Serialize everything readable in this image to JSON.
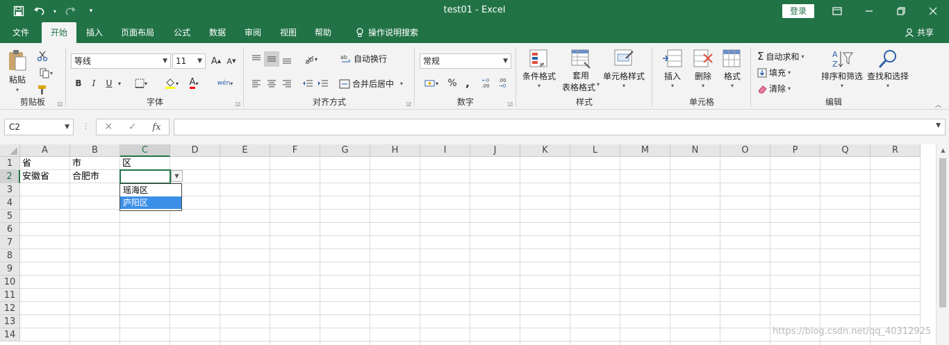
{
  "window": {
    "title": "test01  -  Excel",
    "login_label": "登录",
    "share_label": "共享"
  },
  "tabs": [
    "文件",
    "开始",
    "插入",
    "页面布局",
    "公式",
    "数据",
    "审阅",
    "视图",
    "帮助",
    "操作说明搜索"
  ],
  "ribbon": {
    "clipboard": {
      "label": "剪贴板",
      "paste": "粘贴"
    },
    "font": {
      "label": "字体",
      "name": "等线",
      "size": "11",
      "bold": "B",
      "italic": "I",
      "underline": "U",
      "font_color": "A",
      "grow": "A",
      "shrink": "A",
      "phonetic": "wén"
    },
    "align": {
      "label": "对齐方式",
      "wrap": "自动换行",
      "merge": "合并后居中"
    },
    "number": {
      "label": "数字",
      "format": "常规",
      "percent": "%",
      "comma": ","
    },
    "styles": {
      "label": "样式",
      "cond": "条件格式",
      "table1": "套用",
      "table2": "表格格式",
      "cell": "单元格样式"
    },
    "cells": {
      "label": "单元格",
      "insert": "插入",
      "delete": "删除",
      "format": "格式"
    },
    "editing": {
      "label": "编辑",
      "autosum": "自动求和",
      "fill": "填充",
      "clear": "清除",
      "sort": "排序和筛选",
      "find": "查找和选择"
    }
  },
  "formula_bar": {
    "name_box": "C2",
    "fx": "fx",
    "value": ""
  },
  "columns": [
    "A",
    "B",
    "C",
    "D",
    "E",
    "F",
    "G",
    "H",
    "I",
    "J",
    "K",
    "L",
    "M",
    "N",
    "O",
    "P",
    "Q",
    "R"
  ],
  "selected_column": "C",
  "rows": [
    "1",
    "2",
    "3",
    "4",
    "5",
    "6",
    "7",
    "8",
    "9",
    "10",
    "11",
    "12",
    "13",
    "14"
  ],
  "selected_row": "2",
  "cells": {
    "A1": "省",
    "B1": "市",
    "C1": "区",
    "A2": "安徽省",
    "B2": "合肥市"
  },
  "dropdown": {
    "options": [
      "瑶海区",
      "庐阳区"
    ],
    "highlighted": "庐阳区"
  },
  "watermark": "https://blog.csdn.net/qq_40312925",
  "colors": {
    "accent": "#217346",
    "highlight": "#3c8fe6"
  }
}
